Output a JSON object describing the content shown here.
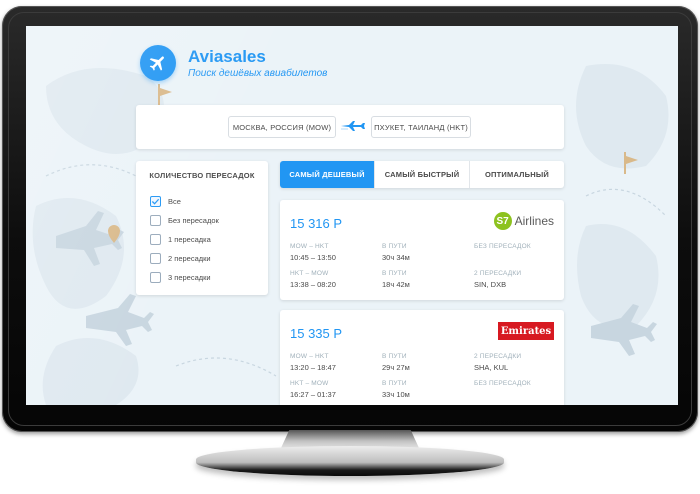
{
  "header": {
    "brand_name": "Aviasales",
    "tagline": "Поиск дешёвых авиабилетов"
  },
  "route": {
    "from": "МОСКВА, РОССИЯ (MOW)",
    "to": "ПХУКЕТ, ТАИЛАНД (HKT)"
  },
  "filters": {
    "title": "КОЛИЧЕСТВО ПЕРЕСАДОК",
    "options": [
      {
        "label": "Все",
        "checked": true
      },
      {
        "label": "Без пересадок",
        "checked": false
      },
      {
        "label": "1 пересадка",
        "checked": false
      },
      {
        "label": "2 пересадки",
        "checked": false
      },
      {
        "label": "3 пересадки",
        "checked": false
      }
    ]
  },
  "tabs": [
    {
      "label": "САМЫЙ ДЕШЕВЫЙ",
      "active": true
    },
    {
      "label": "САМЫЙ БЫСТРЫЙ",
      "active": false
    },
    {
      "label": "ОПТИМАЛЬНЫЙ",
      "active": false
    }
  ],
  "tickets": [
    {
      "price": "15 316 Р",
      "carrier": {
        "mark": "S7",
        "name": "Airlines"
      },
      "segments": [
        {
          "route": "MOW – HKT",
          "time": "10:45 – 13:50",
          "duration_label": "В ПУТИ",
          "duration": "30ч 34м",
          "stops_label": "БЕЗ ПЕРЕСАДОК",
          "stops": ""
        },
        {
          "route": "HKT – MOW",
          "time": "13:38 – 08:20",
          "duration_label": "В ПУТИ",
          "duration": "18ч 42м",
          "stops_label": "2 ПЕРЕСАДКИ",
          "stops": "SIN, DXB"
        }
      ]
    },
    {
      "price": "15 335 Р",
      "carrier": {
        "name": "Emirates"
      },
      "segments": [
        {
          "route": "MOW – HKT",
          "time": "13:20 – 18:47",
          "duration_label": "В ПУТИ",
          "duration": "29ч 27м",
          "stops_label": "2 ПЕРЕСАДКИ",
          "stops": "SHA, KUL"
        },
        {
          "route": "HKT – MOW",
          "time": "16:27 – 01:37",
          "duration_label": "В ПУТИ",
          "duration": "33ч 10м",
          "stops_label": "БЕЗ ПЕРЕСАДОК",
          "stops": ""
        }
      ]
    }
  ],
  "colors": {
    "accent": "#2196f3",
    "screen_bg": "#ebf3f8",
    "s7_green": "#8dc21f",
    "emirates_red": "#d71921"
  },
  "icons": {
    "logo": "airplane-icon",
    "route_separator": "airplane-icon",
    "checkbox_mark": "checkmark-icon"
  }
}
